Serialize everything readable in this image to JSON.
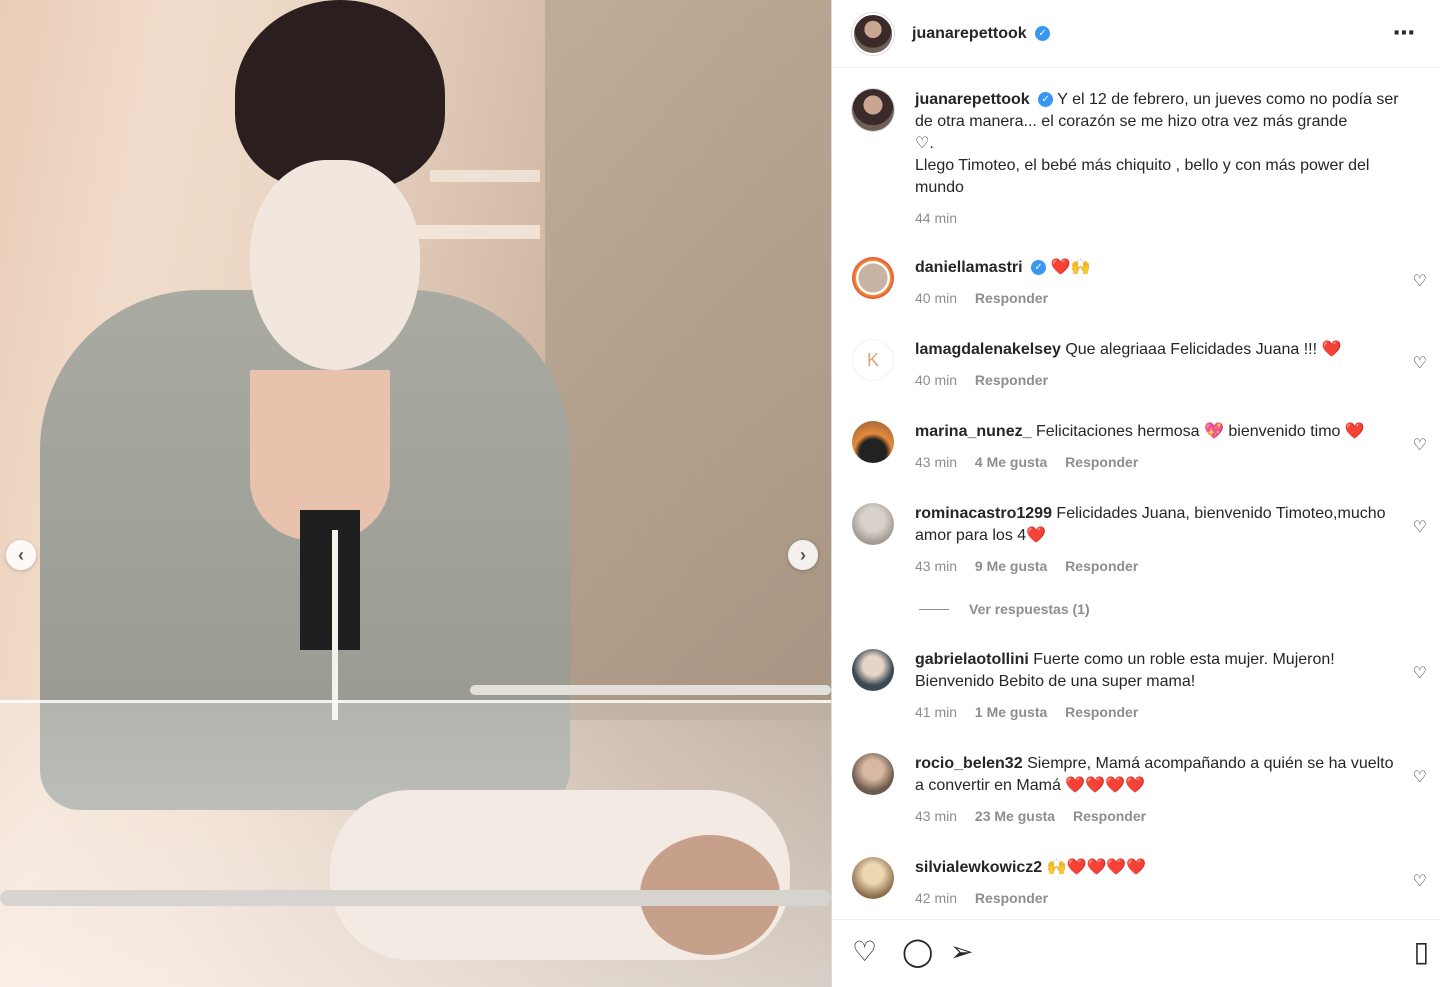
{
  "post": {
    "username": "juanarepettook",
    "more_icon": "⋯",
    "caption_line1": "Y el 12 de febrero, un jueves como no podía ser de otra manera... el corazón se me hizo otra vez más grande",
    "caption_heart": "♡.",
    "caption_line2": "Llego Timoteo, el bebé más chiquito , bello y con más power del mundo",
    "time": "44 min"
  },
  "comments": [
    {
      "user": "daniellamastri",
      "verified": true,
      "text": "❤️🙌",
      "time": "40 min",
      "likes": "",
      "reply": "Responder"
    },
    {
      "user": "lamagdalenakelsey",
      "verified": false,
      "text": "Que alegriaaa Felicidades Juana !!! ❤️",
      "time": "40 min",
      "likes": "",
      "reply": "Responder"
    },
    {
      "user": "marina_nunez_",
      "verified": false,
      "text": "Felicitaciones hermosa 💖 bienvenido timo ❤️",
      "time": "43 min",
      "likes": "4 Me gusta",
      "reply": "Responder"
    },
    {
      "user": "rominacastro1299",
      "verified": false,
      "text": "Felicidades Juana, bienvenido Timoteo,mucho amor para los 4❤️",
      "time": "43 min",
      "likes": "9 Me gusta",
      "reply": "Responder"
    },
    {
      "user": "gabrielaotollini",
      "verified": false,
      "text": "Fuerte como un roble esta mujer. Mujeron! Bienvenido Bebito de una super mama!",
      "time": "41 min",
      "likes": "1 Me gusta",
      "reply": "Responder"
    },
    {
      "user": "rocio_belen32",
      "verified": false,
      "text": "Siempre, Mamá acompañando a quién se ha vuelto a convertir en Mamá ❤️❤️❤️❤️",
      "time": "43 min",
      "likes": "23 Me gusta",
      "reply": "Responder"
    },
    {
      "user": "silvialewkowicz2",
      "verified": false,
      "text": "🙌❤️❤️❤️❤️",
      "time": "42 min",
      "likes": "",
      "reply": "Responder"
    }
  ],
  "view_replies": "Ver respuestas (1)",
  "icons": {
    "prev": "‹",
    "next": "›",
    "like": "♡",
    "comment": "◯",
    "share": "➢",
    "save": "▯",
    "comment_like": "♡",
    "verified": "✓"
  }
}
